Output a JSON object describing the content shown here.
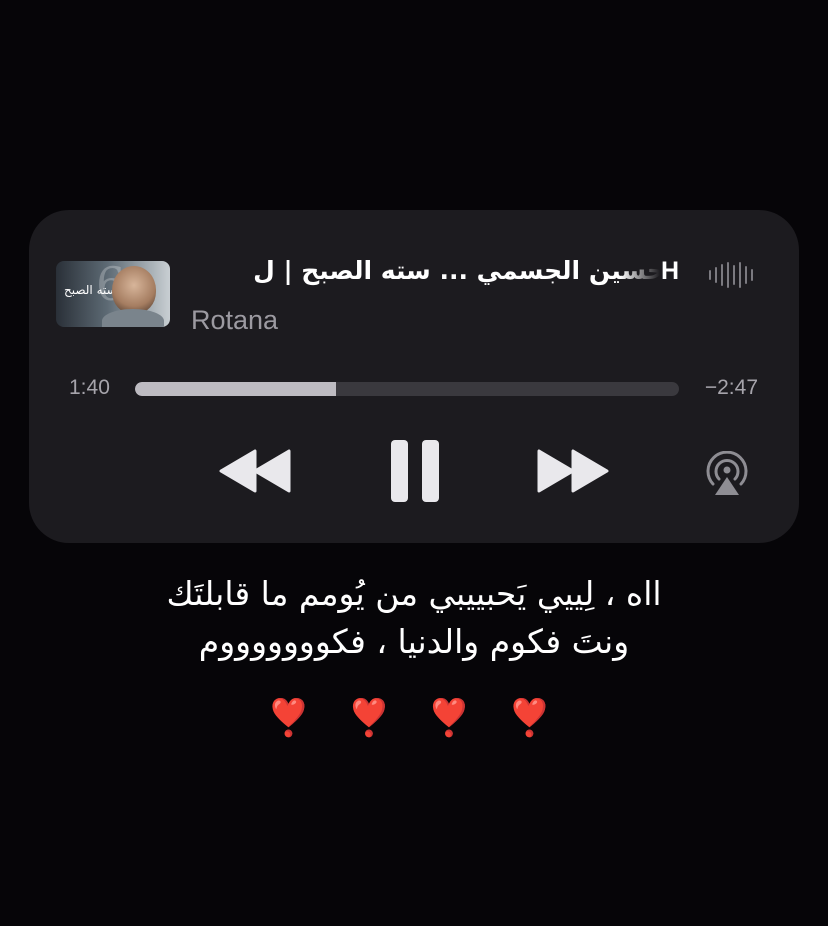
{
  "player": {
    "title": "حسين الجسمي ... سته الصبح | ل",
    "title_marquee_start": "H",
    "artist": "Rotana",
    "artwork_text": "سته الصبح",
    "artwork_number": "6",
    "elapsed": "1:40",
    "remaining": "−2:47",
    "progress_fraction": 0.37,
    "state": "playing",
    "icons": [
      "waveform-icon",
      "rewind-icon",
      "pause-icon",
      "forward-icon",
      "airplay-icon"
    ]
  },
  "lyrics": {
    "line1": "ااه ، لِييي يَحبييبي من يُومم ما قابلتَك",
    "line2": "ونتَ فكوم والدنيا ، فكوووووووم"
  },
  "hearts": [
    "❣️",
    "❣️",
    "❣️",
    "❣️"
  ],
  "colors": {
    "background": "#060508",
    "card": "#1c1b1f",
    "progress_fill": "#bdbbc1",
    "progress_track": "#3a393e",
    "secondary_text": "#9c9aa1"
  }
}
